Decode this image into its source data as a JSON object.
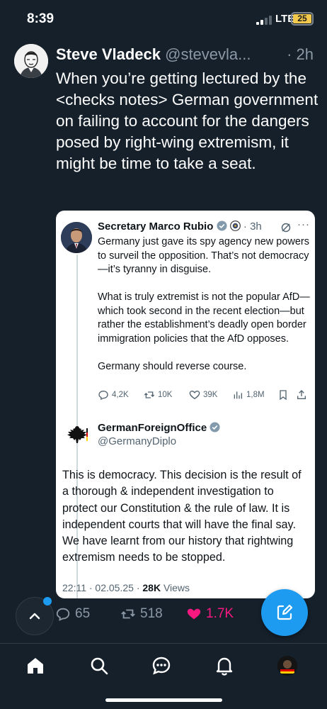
{
  "status_bar": {
    "time": "8:39",
    "network": "LTE",
    "battery": "25"
  },
  "tweet": {
    "author_name": "Steve Vladeck",
    "author_handle": "@stevevla...",
    "time": "· 2h",
    "text": "When you’re getting lectured by the <checks notes> German government on failing to account for the dangers posed by right-wing extremism, it might be time to take a seat."
  },
  "quoted": {
    "reply_tweet": {
      "author_name": "Secretary Marco Rubio",
      "time": "· 3h",
      "paragraphs": [
        "Germany just gave its spy agency new powers to surveil the opposition.  That’s not democracy—it’s tyranny in disguise.",
        "What is truly extremist is not the popular AfD—which took second in the recent election—but rather the establishment’s deadly open border immigration policies that the AfD opposes.",
        "Germany should reverse course."
      ],
      "replies": "4,2K",
      "retweets": "10K",
      "likes": "39K",
      "views": "1,8M"
    },
    "main_tweet": {
      "author_name": "GermanForeignOffice",
      "author_handle": "@GermanyDiplo",
      "text": "This is democracy. This decision is the result of a thorough & independent investigation to protect our Constitution & the rule of law. It is independent courts that will have the final say. We have learnt from our history that rightwing extremism needs to be stopped.",
      "timestamp": "22:11 · 02.05.25 · ",
      "views_count": "28K",
      "views_label": " Views"
    }
  },
  "actions": {
    "replies": "65",
    "retweets": "518",
    "likes": "1.7K"
  },
  "colors": {
    "background": "#15202b",
    "accent": "#1d9bf0",
    "like": "#f91880",
    "muted": "#8b98a5"
  }
}
